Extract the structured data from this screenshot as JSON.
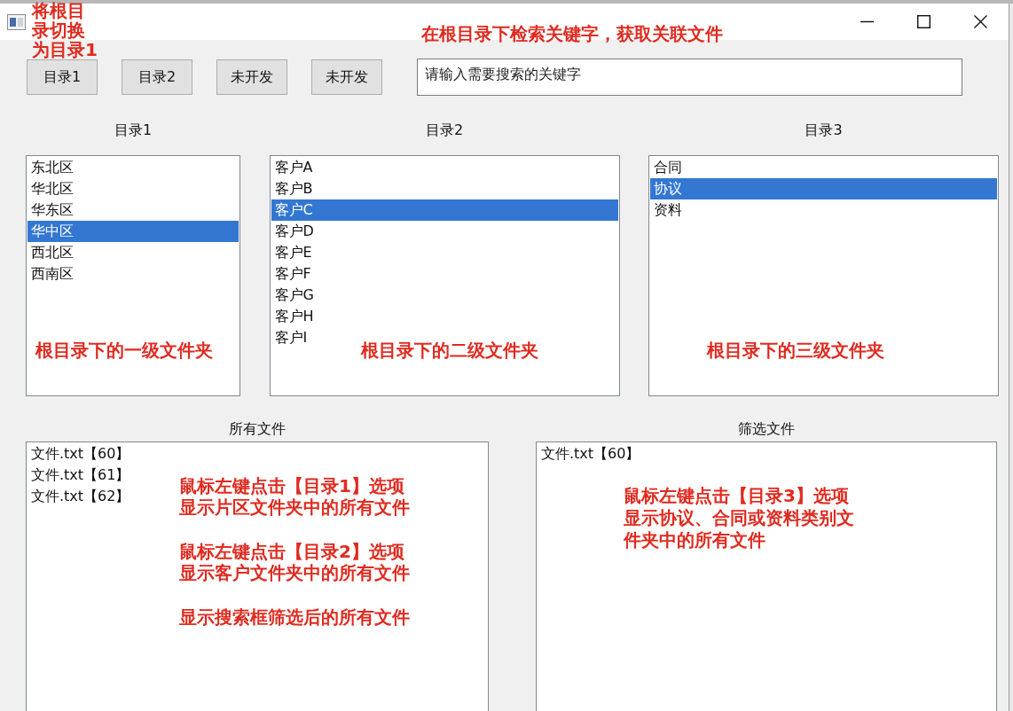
{
  "annotations": [
    {
      "lines": [
        "将根目",
        "录切换",
        "为目录1"
      ]
    },
    {
      "lines": [
        "在根目录下检索关键字，获取关联文件"
      ]
    }
  ],
  "toolbar": {
    "buttons": [
      "目录1",
      "目录2",
      "未开发",
      "未开发"
    ],
    "search": {
      "placeholder": "请输入需要搜索的关键字"
    }
  },
  "folder_lists": [
    {
      "title": "目录1",
      "items": [
        {
          "label": "东北区",
          "selected": false
        },
        {
          "label": "华北区",
          "selected": false
        },
        {
          "label": "华东区",
          "selected": false
        },
        {
          "label": "华中区",
          "selected": true
        },
        {
          "label": "西北区",
          "selected": false
        },
        {
          "label": "西南区",
          "selected": false
        }
      ],
      "note": "根目录下的一级文件夹"
    },
    {
      "title": "目录2",
      "items": [
        {
          "label": "客户A",
          "selected": false
        },
        {
          "label": "客户B",
          "selected": false
        },
        {
          "label": "客户C",
          "selected": true
        },
        {
          "label": "客户D",
          "selected": false
        },
        {
          "label": "客户E",
          "selected": false
        },
        {
          "label": "客户F",
          "selected": false
        },
        {
          "label": "客户G",
          "selected": false
        },
        {
          "label": "客户H",
          "selected": false
        },
        {
          "label": "客户I",
          "selected": false
        }
      ],
      "note": "根目录下的二级文件夹"
    },
    {
      "title": "目录3",
      "items": [
        {
          "label": "合同",
          "selected": false
        },
        {
          "label": "协议",
          "selected": true
        },
        {
          "label": "资料",
          "selected": false
        }
      ],
      "note": "根目录下的三级文件夹"
    }
  ],
  "file_lists": [
    {
      "title": "所有文件",
      "items": [
        {
          "label": "文件.txt【60】",
          "selected": false
        },
        {
          "label": "文件.txt【61】",
          "selected": false
        },
        {
          "label": "文件.txt【62】",
          "selected": false
        }
      ],
      "notes": [
        {
          "lines": [
            "鼠标左键点击【目录1】选项",
            "显示片区文件夹中的所有文件"
          ]
        },
        {
          "lines": [
            "鼠标左键点击【目录2】选项",
            "显示客户文件夹中的所有文件"
          ]
        },
        {
          "lines": [
            "显示搜索框筛选后的所有文件"
          ]
        }
      ]
    },
    {
      "title": "筛选文件",
      "items": [
        {
          "label": "文件.txt【60】",
          "selected": false
        }
      ],
      "notes": [
        {
          "lines": [
            "鼠标左键点击【目录3】选项",
            "显示协议、合同或资料类别文",
            "件夹中的所有文件"
          ]
        }
      ]
    }
  ]
}
